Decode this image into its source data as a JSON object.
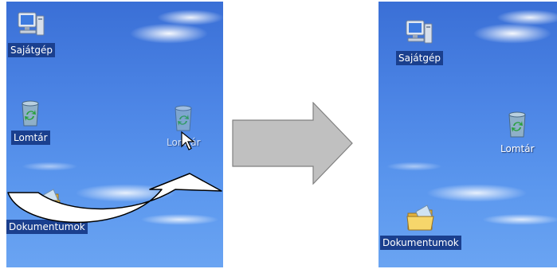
{
  "before": {
    "icons": [
      {
        "label": "Sajátgép",
        "icon": "computer-icon"
      },
      {
        "label": "Lomtár",
        "icon": "recycle-bin-icon"
      },
      {
        "label": "Lomtár",
        "icon": "recycle-bin-icon",
        "state": "dragging"
      },
      {
        "label": "Dokumentumok",
        "icon": "folder-icon"
      }
    ]
  },
  "after": {
    "icons": [
      {
        "label": "Sajátgép",
        "icon": "computer-icon"
      },
      {
        "label": "Lomtár",
        "icon": "recycle-bin-icon"
      },
      {
        "label": "Dokumentumok",
        "icon": "folder-icon"
      }
    ]
  },
  "colors": {
    "desktop_blue": "#4d86e6",
    "label_highlight": "#1a3f8e",
    "arrow_fill": "#c0c0c0"
  }
}
